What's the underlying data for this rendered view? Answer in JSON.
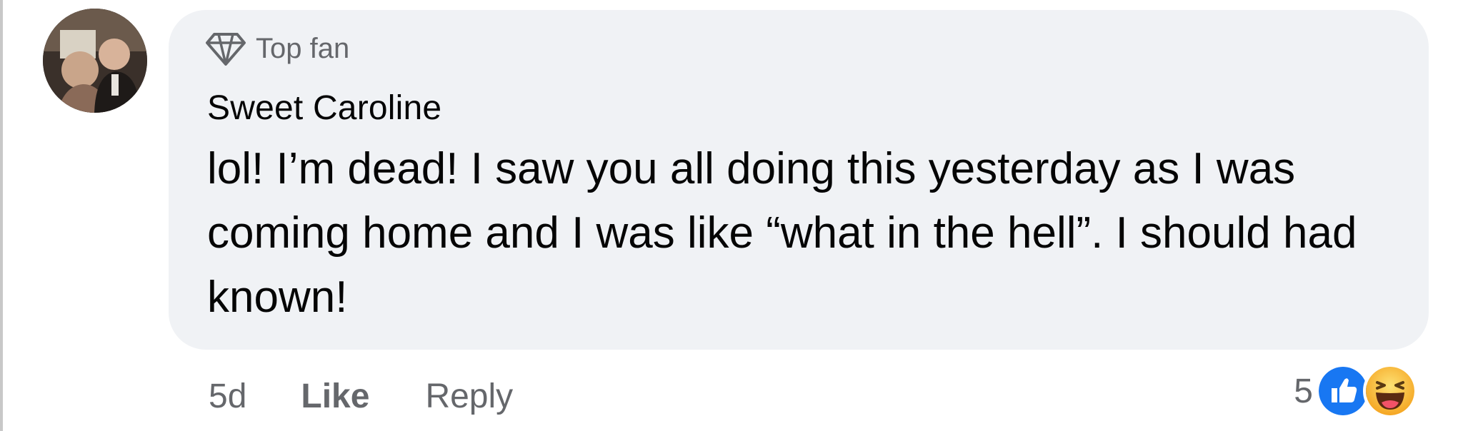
{
  "comment": {
    "badge": "Top fan",
    "author": "Sweet Caroline",
    "text": "lol! I’m dead! I saw you all doing this yesterday as I was coming home and I was like “what in the hell”. I should had known!",
    "badge_icon": "diamond-icon",
    "avatar": "profile-photo"
  },
  "actions": {
    "time": "5d",
    "like_label": "Like",
    "reply_label": "Reply"
  },
  "reactions": {
    "count": "5",
    "icons": [
      "like-reaction-icon",
      "haha-reaction-icon"
    ]
  },
  "colors": {
    "bubble_bg": "#f0f2f5",
    "meta_text": "#65676b",
    "primary_text": "#050505",
    "like_blue": "#1877f2",
    "haha_yellow": "#f7b928"
  }
}
